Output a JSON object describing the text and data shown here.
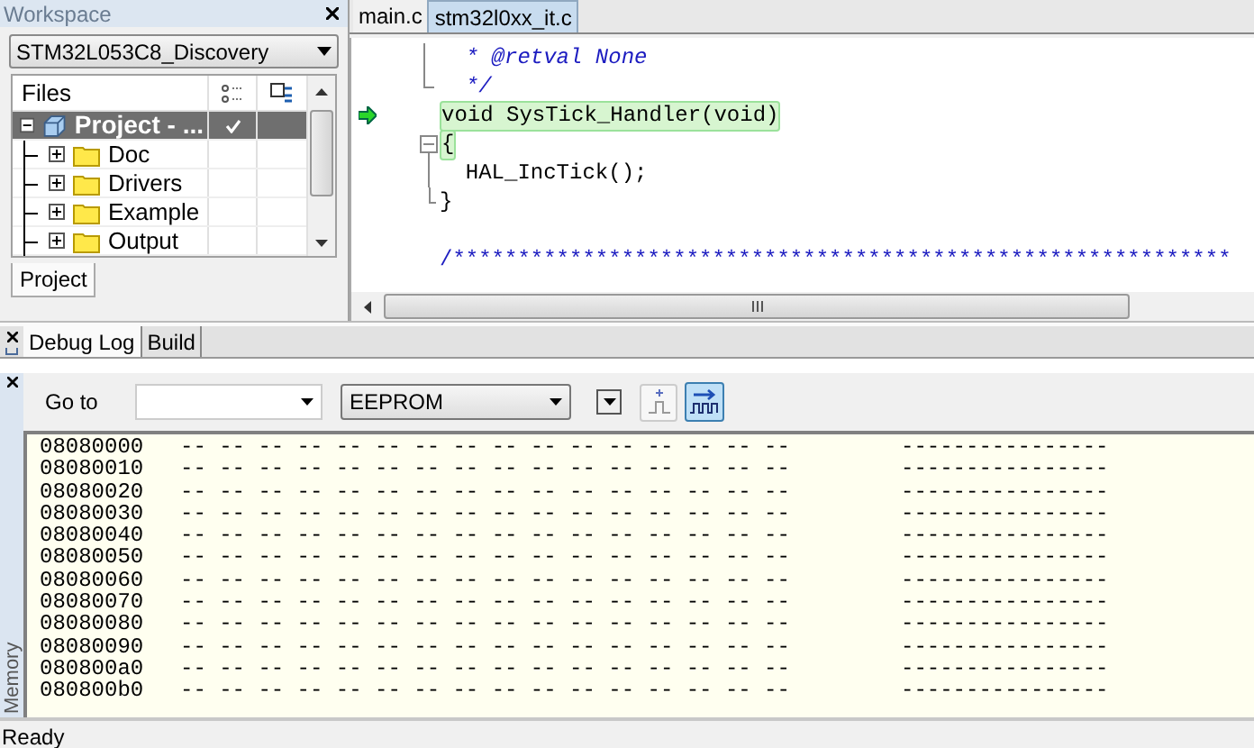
{
  "workspace": {
    "title": "Workspace",
    "config": "STM32L053C8_Discovery",
    "files_header": "Files",
    "tree": [
      {
        "label": "Project - ...",
        "kind": "project",
        "selected": true,
        "checked": true,
        "expanded": true,
        "children": [
          {
            "label": "Doc",
            "kind": "folder",
            "selected": false,
            "checked": false,
            "expanded": false
          },
          {
            "label": "Drivers",
            "kind": "folder",
            "selected": false,
            "checked": false,
            "expanded": false
          },
          {
            "label": "Example",
            "kind": "folder",
            "selected": false,
            "checked": false,
            "expanded": false
          },
          {
            "label": "Output",
            "kind": "folder",
            "selected": false,
            "checked": false,
            "expanded": false
          }
        ]
      }
    ],
    "tabs": [
      {
        "label": "Project",
        "selected": true
      }
    ]
  },
  "editor": {
    "tabs": [
      {
        "label": "main.c",
        "selected": false
      },
      {
        "label": "stm32l0xx_it.c",
        "selected": true
      }
    ],
    "lines": [
      {
        "kind": "comment",
        "text": "  * @retval None",
        "current": false
      },
      {
        "kind": "comment",
        "text": "  */",
        "current": false
      },
      {
        "kind": "code",
        "text": "void SysTick_Handler(void)",
        "current": true
      },
      {
        "kind": "code",
        "text": "{",
        "current": false
      },
      {
        "kind": "code",
        "text": "  HAL_IncTick();",
        "current": false
      },
      {
        "kind": "code",
        "text": "}",
        "current": false
      },
      {
        "kind": "banner",
        "text": "/************************************************************",
        "current": false
      }
    ]
  },
  "output_tabs": [
    {
      "label": "Debug Log",
      "selected": true
    },
    {
      "label": "Build",
      "selected": false
    }
  ],
  "memory": {
    "title": "Memory",
    "goto_label": "Go to",
    "zone": "EEPROM",
    "rows": [
      {
        "address": "08080000",
        "bytes": "-- -- -- -- -- -- -- -- -- -- -- -- -- -- -- --",
        "ascii": "----------------"
      },
      {
        "address": "08080010",
        "bytes": "-- -- -- -- -- -- -- -- -- -- -- -- -- -- -- --",
        "ascii": "----------------"
      },
      {
        "address": "08080020",
        "bytes": "-- -- -- -- -- -- -- -- -- -- -- -- -- -- -- --",
        "ascii": "----------------"
      },
      {
        "address": "08080030",
        "bytes": "-- -- -- -- -- -- -- -- -- -- -- -- -- -- -- --",
        "ascii": "----------------"
      },
      {
        "address": "08080040",
        "bytes": "-- -- -- -- -- -- -- -- -- -- -- -- -- -- -- --",
        "ascii": "----------------"
      },
      {
        "address": "08080050",
        "bytes": "-- -- -- -- -- -- -- -- -- -- -- -- -- -- -- --",
        "ascii": "----------------"
      },
      {
        "address": "08080060",
        "bytes": "-- -- -- -- -- -- -- -- -- -- -- -- -- -- -- --",
        "ascii": "----------------"
      },
      {
        "address": "08080070",
        "bytes": "-- -- -- -- -- -- -- -- -- -- -- -- -- -- -- --",
        "ascii": "----------------"
      },
      {
        "address": "08080080",
        "bytes": "-- -- -- -- -- -- -- -- -- -- -- -- -- -- -- --",
        "ascii": "----------------"
      },
      {
        "address": "08080090",
        "bytes": "-- -- -- -- -- -- -- -- -- -- -- -- -- -- -- --",
        "ascii": "----------------"
      },
      {
        "address": "080800a0",
        "bytes": "-- -- -- -- -- -- -- -- -- -- -- -- -- -- -- --",
        "ascii": "----------------"
      },
      {
        "address": "080800b0",
        "bytes": "-- -- -- -- -- -- -- -- -- -- -- -- -- -- -- --",
        "ascii": "----------------"
      }
    ]
  },
  "status_bar": {
    "text": "Ready"
  }
}
